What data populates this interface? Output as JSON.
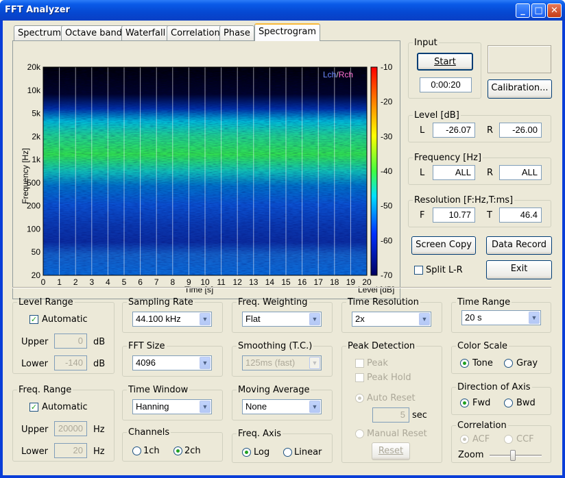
{
  "window": {
    "title": "FFT Analyzer"
  },
  "tabs": [
    "Spectrum",
    "Octave band",
    "Waterfall",
    "Correlation",
    "Phase",
    "Spectrogram"
  ],
  "plot": {
    "legend_lch": "Lch",
    "legend_sep": "/",
    "legend_rch": "Rch",
    "y_label": "Frequency [Hz]",
    "x_label": "Time [s]",
    "colorbar_label": "Level [dB]",
    "y_ticks": [
      "20k",
      "10k",
      "5k",
      "2k",
      "1k",
      "500",
      "200",
      "100",
      "50",
      "20"
    ],
    "x_ticks": [
      "0",
      "1",
      "2",
      "3",
      "4",
      "5",
      "6",
      "7",
      "8",
      "9",
      "10",
      "11",
      "12",
      "13",
      "14",
      "15",
      "16",
      "17",
      "18",
      "19",
      "20"
    ],
    "colorbar_ticks": [
      "-10",
      "-20",
      "-30",
      "-40",
      "-50",
      "-60",
      "-70"
    ],
    "colors": {
      "lch": "#6f8cff",
      "rch": "#ff6fd0"
    }
  },
  "input": {
    "title": "Input",
    "start": "Start",
    "elapsed": "0:00:20",
    "calibration": "Calibration..."
  },
  "level": {
    "title": "Level [dB]",
    "l_label": "L",
    "l_value": "-26.07",
    "r_label": "R",
    "r_value": "-26.00"
  },
  "frequency": {
    "title": "Frequency [Hz]",
    "l_label": "L",
    "l_value": "ALL",
    "r_label": "R",
    "r_value": "ALL"
  },
  "resolution": {
    "title": "Resolution [F:Hz,T:ms]",
    "f_label": "F",
    "f_value": "10.77",
    "t_label": "T",
    "t_value": "46.4"
  },
  "buttons": {
    "screen_copy": "Screen Copy",
    "data_record": "Data Record",
    "split": "Split L-R",
    "exit": "Exit"
  },
  "level_range": {
    "title": "Level Range",
    "automatic": "Automatic",
    "upper_label": "Upper",
    "upper_value": "0",
    "upper_unit": "dB",
    "lower_label": "Lower",
    "lower_value": "-140",
    "lower_unit": "dB"
  },
  "freq_range": {
    "title": "Freq. Range",
    "automatic": "Automatic",
    "upper_label": "Upper",
    "upper_value": "20000",
    "upper_unit": "Hz",
    "lower_label": "Lower",
    "lower_value": "20",
    "lower_unit": "Hz"
  },
  "sampling_rate": {
    "title": "Sampling Rate",
    "value": "44.100 kHz"
  },
  "fft_size": {
    "title": "FFT Size",
    "value": "4096"
  },
  "time_window": {
    "title": "Time Window",
    "value": "Hanning"
  },
  "channels": {
    "title": "Channels",
    "opt1": "1ch",
    "opt2": "2ch"
  },
  "freq_weighting": {
    "title": "Freq. Weighting",
    "value": "Flat"
  },
  "smoothing": {
    "title": "Smoothing (T.C.)",
    "value": "125ms (fast)"
  },
  "moving_average": {
    "title": "Moving Average",
    "value": "None"
  },
  "freq_axis": {
    "title": "Freq. Axis",
    "opt1": "Log",
    "opt2": "Linear"
  },
  "time_resolution": {
    "title": "Time Resolution",
    "value": "2x"
  },
  "peak_detection": {
    "title": "Peak Detection",
    "peak": "Peak",
    "peak_hold": "Peak Hold",
    "auto_reset": "Auto Reset",
    "seconds": "5",
    "sec_unit": "sec",
    "manual_reset": "Manual Reset",
    "reset": "Reset"
  },
  "time_range": {
    "title": "Time Range",
    "value": "20 s"
  },
  "color_scale": {
    "title": "Color Scale",
    "opt1": "Tone",
    "opt2": "Gray"
  },
  "direction": {
    "title": "Direction of Axis",
    "opt1": "Fwd",
    "opt2": "Bwd"
  },
  "correlation": {
    "title": "Correlation",
    "opt1": "ACF",
    "opt2": "CCF",
    "zoom": "Zoom"
  }
}
